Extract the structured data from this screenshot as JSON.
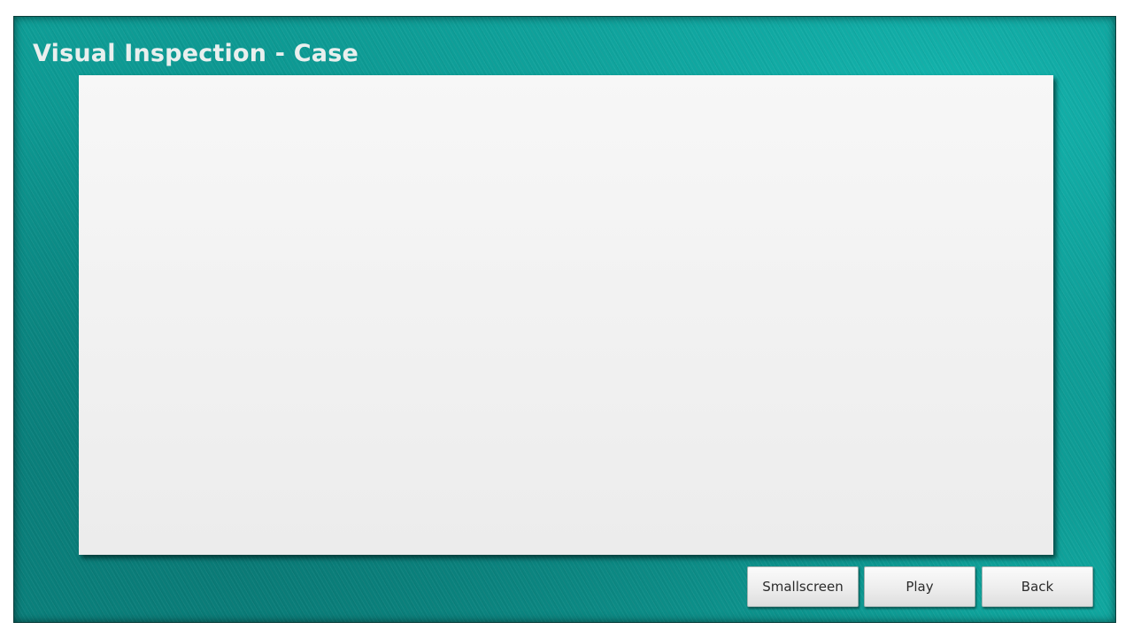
{
  "title": "Visual Inspection - Case",
  "buttons": {
    "smallscreen": "Smallscreen",
    "play": "Play",
    "back": "Back"
  },
  "colors": {
    "background_teal": "#0c948e",
    "title_text": "#e9efee",
    "viewer_background": "#f2f2f2",
    "button_background": "#efefef"
  }
}
